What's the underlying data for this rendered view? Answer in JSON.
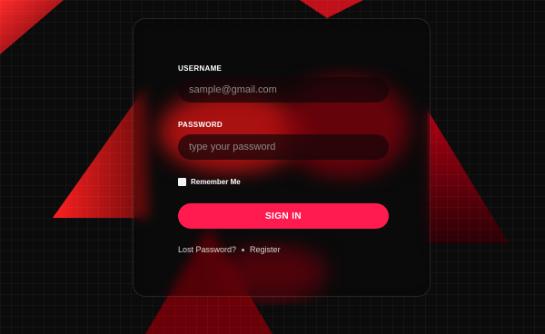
{
  "login": {
    "username_label": "USERNAME",
    "username_placeholder": "sample@gmail.com",
    "password_label": "PASSWORD",
    "password_placeholder": "type your password",
    "remember_label": "Remember Me",
    "signin_label": "SIGN IN",
    "lost_password_label": "Lost Password?",
    "register_label": "Register"
  },
  "colors": {
    "background": "#0b0b0c",
    "accent": "#ff1b4f",
    "shape_red": "#e3121f"
  }
}
